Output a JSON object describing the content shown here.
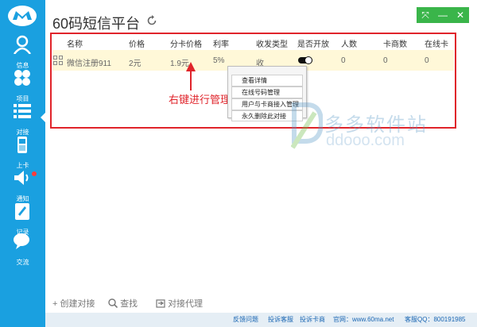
{
  "app": {
    "title": "60码短信平台"
  },
  "sidebar": {
    "items": [
      {
        "label": "信息",
        "icon": "user-icon"
      },
      {
        "label": "项目",
        "icon": "clover-icon"
      },
      {
        "label": "对接",
        "icon": "list-icon"
      },
      {
        "label": "上卡",
        "icon": "phone-icon"
      },
      {
        "label": "通知",
        "icon": "speaker-icon"
      },
      {
        "label": "记录",
        "icon": "notebook-icon"
      },
      {
        "label": "交流",
        "icon": "chat-icon"
      }
    ]
  },
  "table": {
    "headers": [
      "名称",
      "价格",
      "分卡价格",
      "利率",
      "收发类型",
      "是否开放",
      "人数",
      "卡商数",
      "在线卡数"
    ],
    "row": {
      "name": "微信注册911",
      "price": "2元",
      "split_price": "1.9元",
      "rate": "5%",
      "type": "收",
      "people": "0",
      "merchants": "0",
      "online_cards": "0"
    }
  },
  "context_menu": {
    "items": [
      "查看详情",
      "在线号码管理",
      "用户与卡商接入管理",
      "永久删除此对接"
    ]
  },
  "annotation": {
    "text": "右键进行管理"
  },
  "watermark": {
    "cn": "多多软件站",
    "url": "ddooo.com"
  },
  "actions": {
    "create": "+ 创建对接",
    "search": "查找",
    "agent": "对接代理"
  },
  "footer": {
    "feedback": "反馈问题",
    "complain_service": "投诉客服",
    "complain_merchant": "投诉卡商",
    "website": "官网：www.60ma.net",
    "qq": "客服QQ：800191985"
  },
  "colors": {
    "sidebar": "#1aa0e0",
    "accent_red": "#e0242b",
    "window_control": "#3ab54a",
    "row_highlight": "#fff8d8"
  }
}
